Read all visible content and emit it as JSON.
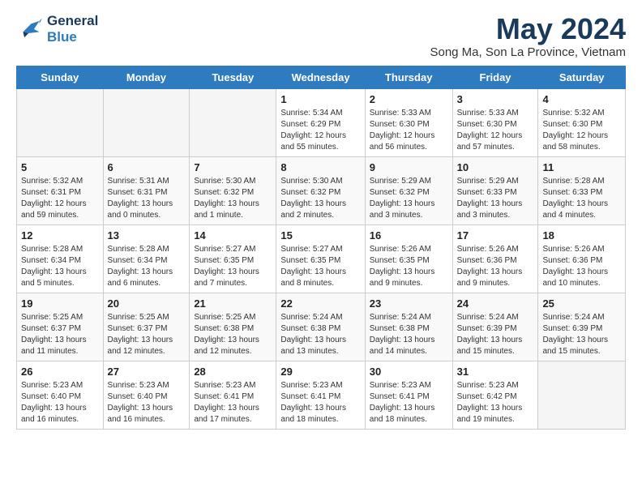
{
  "header": {
    "logo_line1": "General",
    "logo_line2": "Blue",
    "month_title": "May 2024",
    "subtitle": "Song Ma, Son La Province, Vietnam"
  },
  "days_of_week": [
    "Sunday",
    "Monday",
    "Tuesday",
    "Wednesday",
    "Thursday",
    "Friday",
    "Saturday"
  ],
  "weeks": [
    [
      {
        "day": "",
        "info": ""
      },
      {
        "day": "",
        "info": ""
      },
      {
        "day": "",
        "info": ""
      },
      {
        "day": "1",
        "info": "Sunrise: 5:34 AM\nSunset: 6:29 PM\nDaylight: 12 hours\nand 55 minutes."
      },
      {
        "day": "2",
        "info": "Sunrise: 5:33 AM\nSunset: 6:30 PM\nDaylight: 12 hours\nand 56 minutes."
      },
      {
        "day": "3",
        "info": "Sunrise: 5:33 AM\nSunset: 6:30 PM\nDaylight: 12 hours\nand 57 minutes."
      },
      {
        "day": "4",
        "info": "Sunrise: 5:32 AM\nSunset: 6:30 PM\nDaylight: 12 hours\nand 58 minutes."
      }
    ],
    [
      {
        "day": "5",
        "info": "Sunrise: 5:32 AM\nSunset: 6:31 PM\nDaylight: 12 hours\nand 59 minutes."
      },
      {
        "day": "6",
        "info": "Sunrise: 5:31 AM\nSunset: 6:31 PM\nDaylight: 13 hours\nand 0 minutes."
      },
      {
        "day": "7",
        "info": "Sunrise: 5:30 AM\nSunset: 6:32 PM\nDaylight: 13 hours\nand 1 minute."
      },
      {
        "day": "8",
        "info": "Sunrise: 5:30 AM\nSunset: 6:32 PM\nDaylight: 13 hours\nand 2 minutes."
      },
      {
        "day": "9",
        "info": "Sunrise: 5:29 AM\nSunset: 6:32 PM\nDaylight: 13 hours\nand 3 minutes."
      },
      {
        "day": "10",
        "info": "Sunrise: 5:29 AM\nSunset: 6:33 PM\nDaylight: 13 hours\nand 3 minutes."
      },
      {
        "day": "11",
        "info": "Sunrise: 5:28 AM\nSunset: 6:33 PM\nDaylight: 13 hours\nand 4 minutes."
      }
    ],
    [
      {
        "day": "12",
        "info": "Sunrise: 5:28 AM\nSunset: 6:34 PM\nDaylight: 13 hours\nand 5 minutes."
      },
      {
        "day": "13",
        "info": "Sunrise: 5:28 AM\nSunset: 6:34 PM\nDaylight: 13 hours\nand 6 minutes."
      },
      {
        "day": "14",
        "info": "Sunrise: 5:27 AM\nSunset: 6:35 PM\nDaylight: 13 hours\nand 7 minutes."
      },
      {
        "day": "15",
        "info": "Sunrise: 5:27 AM\nSunset: 6:35 PM\nDaylight: 13 hours\nand 8 minutes."
      },
      {
        "day": "16",
        "info": "Sunrise: 5:26 AM\nSunset: 6:35 PM\nDaylight: 13 hours\nand 9 minutes."
      },
      {
        "day": "17",
        "info": "Sunrise: 5:26 AM\nSunset: 6:36 PM\nDaylight: 13 hours\nand 9 minutes."
      },
      {
        "day": "18",
        "info": "Sunrise: 5:26 AM\nSunset: 6:36 PM\nDaylight: 13 hours\nand 10 minutes."
      }
    ],
    [
      {
        "day": "19",
        "info": "Sunrise: 5:25 AM\nSunset: 6:37 PM\nDaylight: 13 hours\nand 11 minutes."
      },
      {
        "day": "20",
        "info": "Sunrise: 5:25 AM\nSunset: 6:37 PM\nDaylight: 13 hours\nand 12 minutes."
      },
      {
        "day": "21",
        "info": "Sunrise: 5:25 AM\nSunset: 6:38 PM\nDaylight: 13 hours\nand 12 minutes."
      },
      {
        "day": "22",
        "info": "Sunrise: 5:24 AM\nSunset: 6:38 PM\nDaylight: 13 hours\nand 13 minutes."
      },
      {
        "day": "23",
        "info": "Sunrise: 5:24 AM\nSunset: 6:38 PM\nDaylight: 13 hours\nand 14 minutes."
      },
      {
        "day": "24",
        "info": "Sunrise: 5:24 AM\nSunset: 6:39 PM\nDaylight: 13 hours\nand 15 minutes."
      },
      {
        "day": "25",
        "info": "Sunrise: 5:24 AM\nSunset: 6:39 PM\nDaylight: 13 hours\nand 15 minutes."
      }
    ],
    [
      {
        "day": "26",
        "info": "Sunrise: 5:23 AM\nSunset: 6:40 PM\nDaylight: 13 hours\nand 16 minutes."
      },
      {
        "day": "27",
        "info": "Sunrise: 5:23 AM\nSunset: 6:40 PM\nDaylight: 13 hours\nand 16 minutes."
      },
      {
        "day": "28",
        "info": "Sunrise: 5:23 AM\nSunset: 6:41 PM\nDaylight: 13 hours\nand 17 minutes."
      },
      {
        "day": "29",
        "info": "Sunrise: 5:23 AM\nSunset: 6:41 PM\nDaylight: 13 hours\nand 18 minutes."
      },
      {
        "day": "30",
        "info": "Sunrise: 5:23 AM\nSunset: 6:41 PM\nDaylight: 13 hours\nand 18 minutes."
      },
      {
        "day": "31",
        "info": "Sunrise: 5:23 AM\nSunset: 6:42 PM\nDaylight: 13 hours\nand 19 minutes."
      },
      {
        "day": "",
        "info": ""
      }
    ]
  ]
}
